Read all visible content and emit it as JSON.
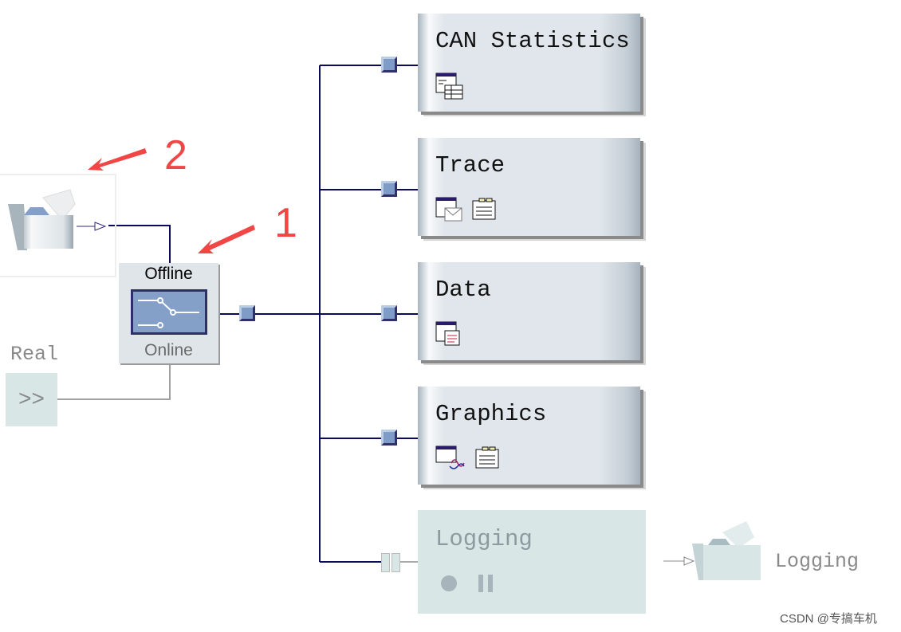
{
  "blocks": [
    {
      "label": "CAN Statistics",
      "icons": [
        "statistics-window-icon"
      ]
    },
    {
      "label": "Trace",
      "icons": [
        "message-window-icon",
        "notes-icon"
      ]
    },
    {
      "label": "Data",
      "icons": [
        "data-window-icon"
      ]
    },
    {
      "label": "Graphics",
      "icons": [
        "graphics-window-icon",
        "notes-icon"
      ]
    }
  ],
  "logging": {
    "label": "Logging",
    "node_label": "Logging",
    "icons": [
      "record-icon",
      "pause-icon"
    ]
  },
  "switch": {
    "top_label": "Offline",
    "bottom_label": "Online"
  },
  "real": {
    "label": "Real"
  },
  "annotations": {
    "one": "1",
    "two": "2"
  },
  "watermark": "CSDN @专搞车机",
  "colors": {
    "line": "#0a0a5a",
    "block": "#e0e6eb",
    "disabled": "#d8e6e6",
    "annotation": "#f04646"
  }
}
